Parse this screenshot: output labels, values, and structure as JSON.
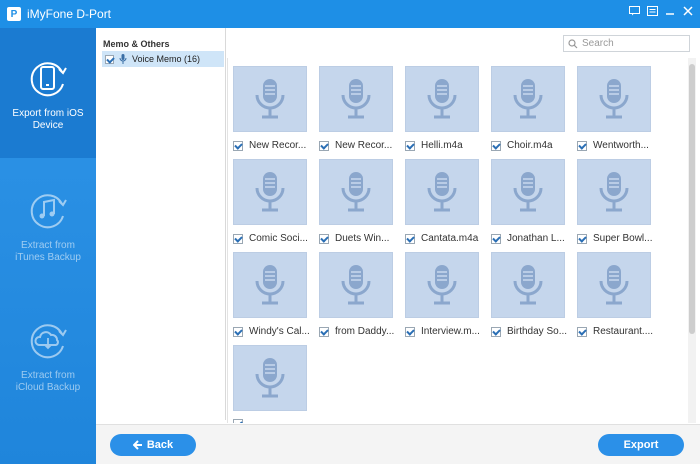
{
  "app": {
    "title": "iMyFone D-Port"
  },
  "sidebar": {
    "items": [
      {
        "label": "Export from iOS Device",
        "active": true
      },
      {
        "label": "Extract from iTunes Backup",
        "active": false
      },
      {
        "label": "Extract from iCloud Backup",
        "active": false
      }
    ]
  },
  "categories": {
    "heading": "Memo & Others",
    "items": [
      {
        "label": "Voice Memo (16)",
        "checked": true
      }
    ]
  },
  "search": {
    "placeholder": "Search"
  },
  "files": [
    {
      "name": "New Recor...",
      "checked": true
    },
    {
      "name": "New Recor...",
      "checked": true
    },
    {
      "name": "Helli.m4a",
      "checked": true
    },
    {
      "name": "Choir.m4a",
      "checked": true
    },
    {
      "name": "Wentworth...",
      "checked": true
    },
    {
      "name": "Comic Soci...",
      "checked": true
    },
    {
      "name": "Duets Win...",
      "checked": true
    },
    {
      "name": "Cantata.m4a",
      "checked": true
    },
    {
      "name": "Jonathan L...",
      "checked": true
    },
    {
      "name": "Super Bowl...",
      "checked": true
    },
    {
      "name": "Windy's Cal...",
      "checked": true
    },
    {
      "name": "from Daddy...",
      "checked": true
    },
    {
      "name": "Interview.m...",
      "checked": true
    },
    {
      "name": "Birthday So...",
      "checked": true
    },
    {
      "name": "Restaurant....",
      "checked": true
    },
    {
      "name": "",
      "checked": true
    }
  ],
  "buttons": {
    "back": "Back",
    "export": "Export"
  },
  "colors": {
    "titlebar": "#1e8fe6",
    "sidebar": "#2f95e8",
    "accent": "#2b90e8",
    "thumb": "#c5d6ec",
    "mic": "#7f9ec7"
  },
  "icons": {
    "sidebar": [
      "phone-export-icon",
      "itunes-music-icon",
      "icloud-download-icon"
    ],
    "file": "microphone-icon"
  }
}
